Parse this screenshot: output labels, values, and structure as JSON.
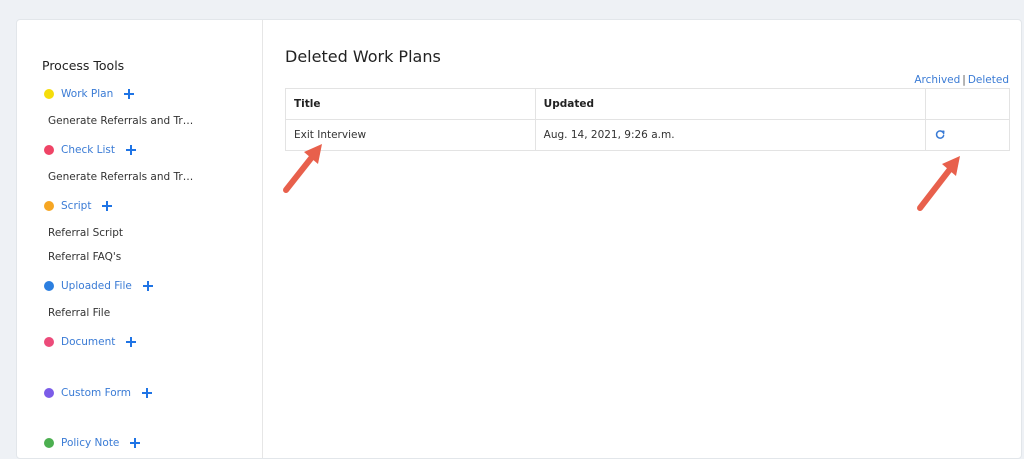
{
  "sidebar": {
    "title": "Process Tools",
    "categories": [
      {
        "label": "Work Plan",
        "color": "#f5dd0b",
        "items": [
          "Generate Referrals and Trainings"
        ]
      },
      {
        "label": "Check List",
        "color": "#ef4466",
        "items": [
          "Generate Referrals and Trainings"
        ]
      },
      {
        "label": "Script",
        "color": "#f6a623",
        "items": [
          "Referral Script",
          "Referral FAQ's"
        ]
      },
      {
        "label": "Uploaded File",
        "color": "#2c7fe0",
        "items": [
          "Referral File"
        ]
      },
      {
        "label": "Document",
        "color": "#ec4b7a",
        "items": []
      },
      {
        "label": "Custom Form",
        "color": "#7b5ce8",
        "items": []
      },
      {
        "label": "Policy Note",
        "color": "#4caf50",
        "items": []
      }
    ]
  },
  "main": {
    "title": "Deleted Work Plans",
    "links": {
      "archived": "Archived",
      "separator": "|",
      "deleted": "Deleted"
    },
    "table": {
      "headers": [
        "Title",
        "Updated",
        ""
      ],
      "rows": [
        {
          "title": "Exit Interview",
          "updated": "Aug. 14, 2021, 9:26 a.m."
        }
      ]
    }
  },
  "colors": {
    "accent": "#3a7bd5",
    "arrow": "#e8604c"
  }
}
